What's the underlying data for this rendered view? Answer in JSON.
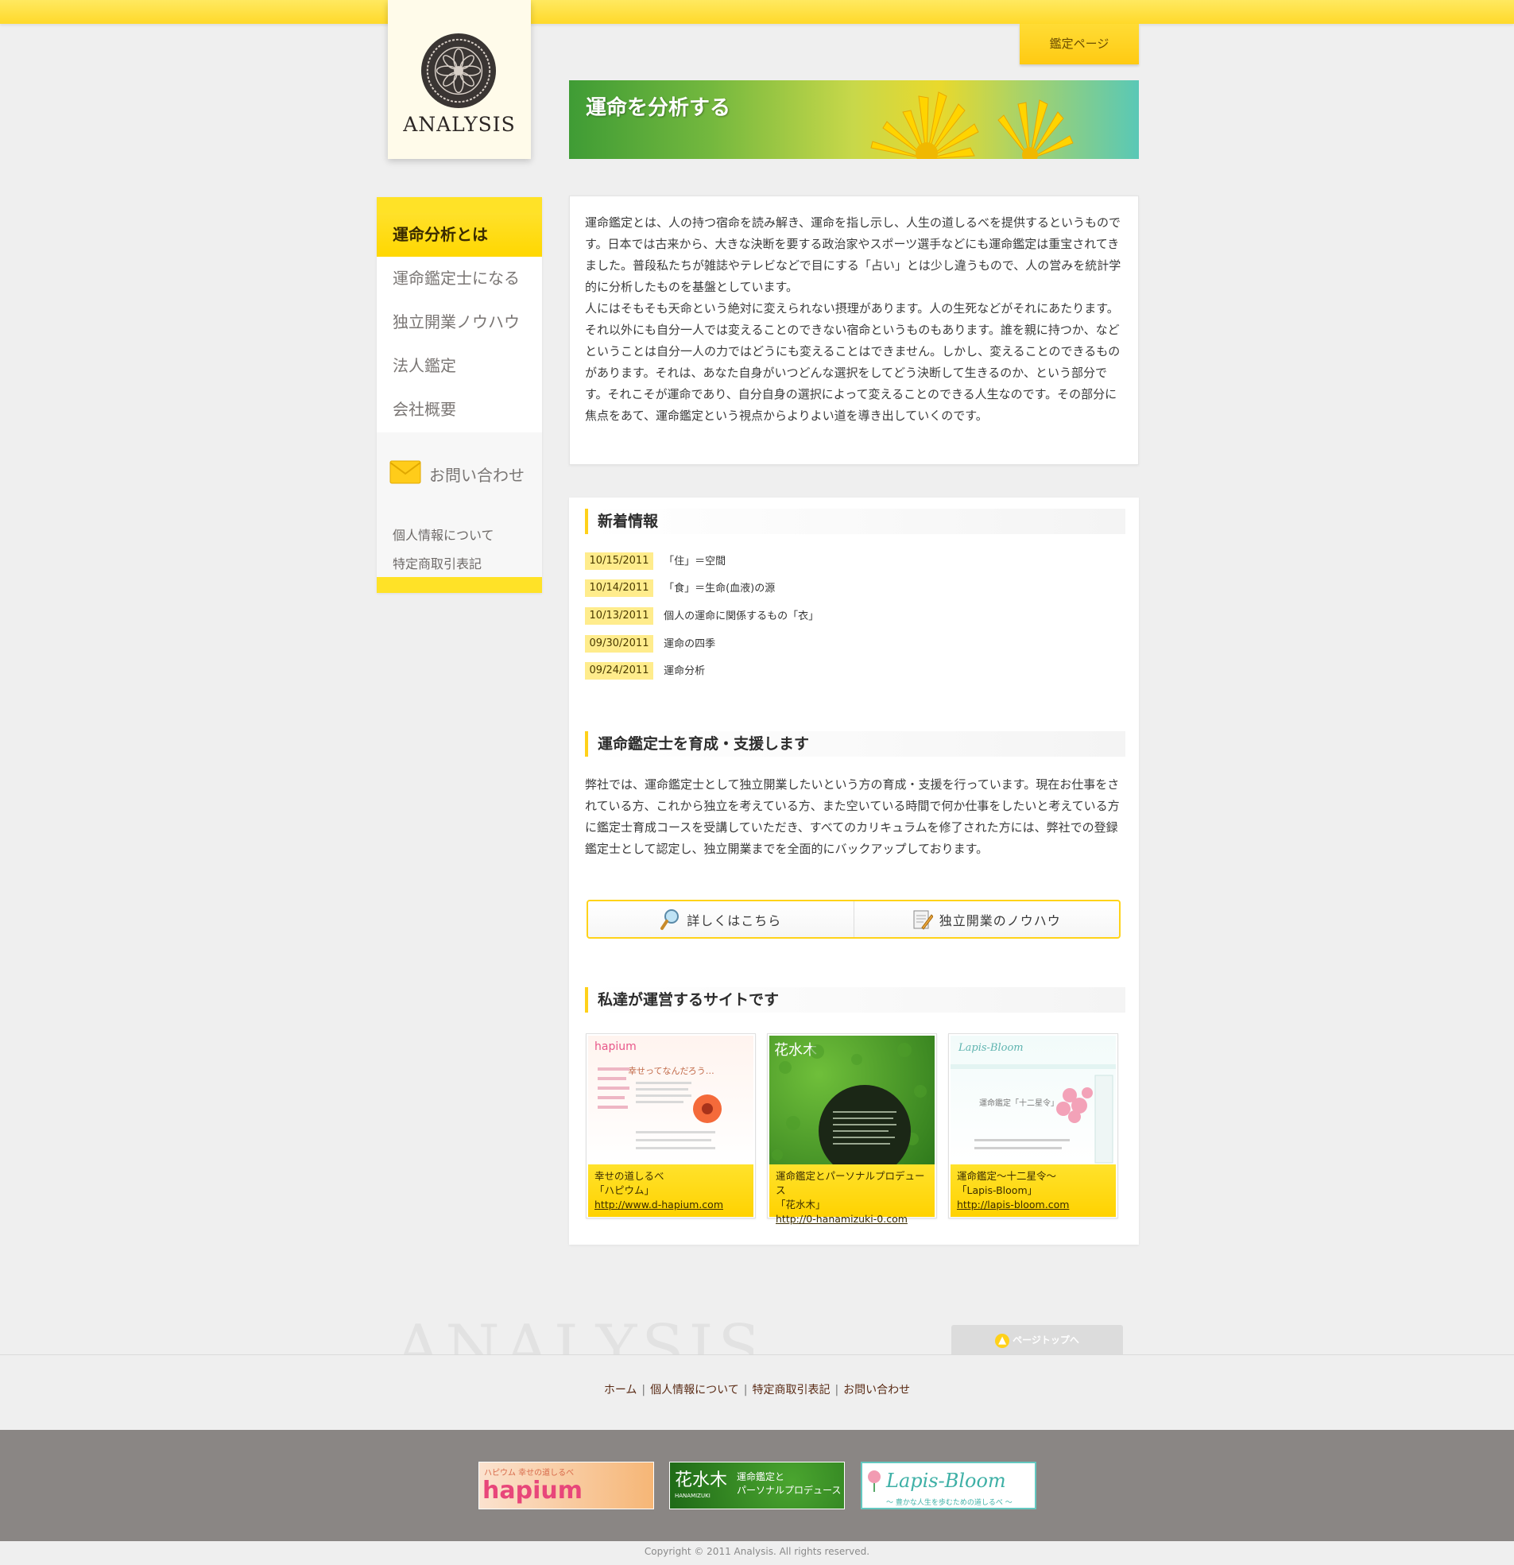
{
  "header": {
    "logo_text": "ANALYSIS",
    "kantei_button": "鑑定ページ",
    "hero_title": "運命を分析する"
  },
  "sidebar": {
    "items": [
      {
        "label": "運命分析とは",
        "active": true
      },
      {
        "label": "運命鑑定士になる",
        "active": false
      },
      {
        "label": "独立開業ノウハウ",
        "active": false
      },
      {
        "label": "法人鑑定",
        "active": false
      },
      {
        "label": "会社概要",
        "active": false
      }
    ],
    "contact_label": "お問い合わせ",
    "privacy_link": "個人情報について",
    "tokutei_link": "特定商取引表記"
  },
  "intro": {
    "text": "運命鑑定とは、人の持つ宿命を読み解き、運命を指し示し、人生の道しるべを提供するというものです。日本では古来から、大きな決断を要する政治家やスポーツ選手などにも運命鑑定は重宝されてきました。普段私たちが雑誌やテレビなどで目にする「占い」とは少し違うもので、人の営みを統計学的に分析したものを基盤としています。\n人にはそもそも天命という絶対に変えられない摂理があります。人の生死などがそれにあたります。それ以外にも自分一人では変えることのできない宿命というものもあります。誰を親に持つか、などということは自分一人の力ではどうにも変えることはできません。しかし、変えることのできるものがあります。それは、あなた自身がいつどんな選択をしてどう決断して生きるのか、という部分です。それこそが運命であり、自分自身の選択によって変えることのできる人生なのです。その部分に焦点をあて、運命鑑定という視点からよりよい道を導き出していくのです。"
  },
  "news": {
    "heading": "新着情報",
    "items": [
      {
        "date": "10/15/2011",
        "title": "「住」＝空間"
      },
      {
        "date": "10/14/2011",
        "title": "「食」＝生命(血液)の源"
      },
      {
        "date": "10/13/2011",
        "title": "個人の運命に関係するもの「衣」"
      },
      {
        "date": "09/30/2011",
        "title": "運命の四季"
      },
      {
        "date": "09/24/2011",
        "title": "運命分析"
      }
    ]
  },
  "support": {
    "heading": "運命鑑定士を育成・支援します",
    "text": "弊社では、運命鑑定士として独立開業したいという方の育成・支援を行っています。現在お仕事をされている方、これから独立を考えている方、また空いている時間で何か仕事をしたいと考えている方に鑑定士育成コースを受講していただき、すべてのカリキュラムを修了された方には、弊社での登録鑑定士として認定し、独立開業までを全面的にバックアップしております。",
    "button_details": "詳しくはこちら",
    "button_knowhow": "独立開業のノウハウ"
  },
  "sites": {
    "heading": "私達が運営するサイトです",
    "cards": [
      {
        "line1": "幸せの道しるべ",
        "line2": "「ハピウム」",
        "url": "http://www.d-hapium.com",
        "thumb_brand": "hapium",
        "thumb_caption": "幸せってなんだろう…"
      },
      {
        "line1": "運命鑑定とパーソナルプロデュース",
        "line2": "「花水木」",
        "url": "http://0-hanamizuki-0.com",
        "thumb_brand": "花水木"
      },
      {
        "line1": "運命鑑定～十二星令～",
        "line2": "「Lapis-Bloom」",
        "url": "http://lapis-bloom.com",
        "thumb_brand": "Lapis-Bloom",
        "thumb_caption": "運命鑑定「十二星令」"
      }
    ]
  },
  "footer": {
    "watermark": "ANALYSIS",
    "page_top": "ページトップへ",
    "links": [
      "ホーム",
      "個人情報について",
      "特定商取引表記",
      "お問い合わせ"
    ],
    "banners": [
      {
        "brand": "hapium",
        "tagline": "ハピウム 幸せの道しるべ"
      },
      {
        "brand": "花水木",
        "sub": "HANAMIZUKI",
        "tagline1": "運命鑑定と",
        "tagline2": "パーソナルプロデュース"
      },
      {
        "brand": "Lapis-Bloom",
        "tagline": "～ 豊かな人生を歩むための道しるべ ～"
      }
    ],
    "copyright": "Copyright © 2011 Analysis. All rights reserved."
  },
  "colors": {
    "accent_yellow": "#ffd700",
    "top_bar": "#ffe960",
    "footer_gray": "#8a8684",
    "link_brown": "#5a2b15"
  }
}
